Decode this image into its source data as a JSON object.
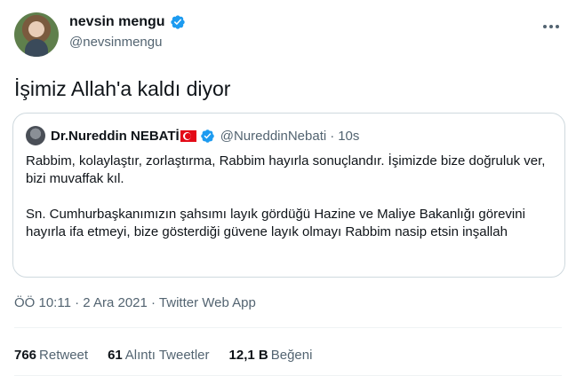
{
  "author": {
    "display_name": "nevsin mengu",
    "handle": "@nevsinmengu",
    "verified_icon": "verified-badge-icon"
  },
  "tweet": {
    "text": "İşimiz Allah'a kaldı diyor"
  },
  "quoted": {
    "display_name": "Dr.Nureddin NEBATİ",
    "flag_icon": "turkey-flag-icon",
    "handle": "@NureddinNebati",
    "separator": "·",
    "time": "10s",
    "paragraphs": [
      "Rabbim, kolaylaştır, zorlaştırma, Rabbim hayırla sonuçlandır. İşimizde bize doğruluk ver, bizi muvaffak kıl.",
      "Sn. Cumhurbaşkanımızın şahsımı layık gördüğü Hazine ve Maliye Bakanlığı görevini hayırla ifa etmeyi, bize gösterdiği güvene layık olmayı Rabbim nasip etsin inşallah"
    ]
  },
  "meta": {
    "time": "ÖÖ 10:11",
    "separator": "·",
    "date": "2 Ara 2021",
    "source": "Twitter Web App"
  },
  "stats": {
    "retweets_count": "766",
    "retweets_label": "Retweet",
    "quotes_count": "61",
    "quotes_label": "Alıntı Tweetler",
    "likes_count": "12,1 B",
    "likes_label": "Beğeni"
  },
  "colors": {
    "text": "#0f1419",
    "secondary": "#536471",
    "verified": "#1d9bf0",
    "border": "#cfd9de",
    "flag_red": "#e30a17"
  }
}
